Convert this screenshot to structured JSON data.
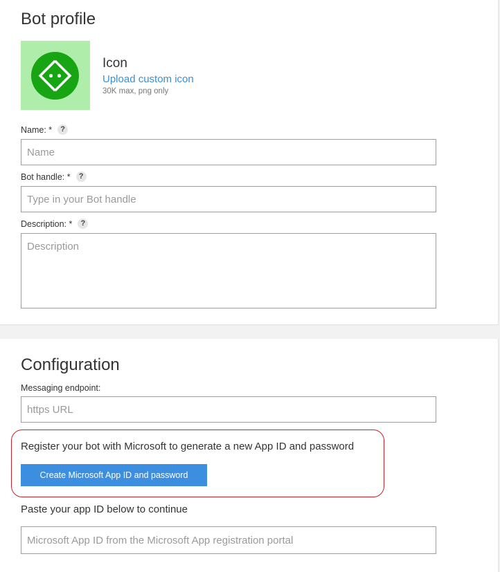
{
  "bot_profile": {
    "title": "Bot profile",
    "icon": {
      "heading": "Icon",
      "upload_link": "Upload custom icon",
      "hint": "30K max, png only",
      "bg_color": "#aeeeaa",
      "circle_color": "#17a514",
      "glyph": "code-brackets-icon"
    },
    "fields": {
      "name": {
        "label": "Name: *",
        "help": "?",
        "placeholder": "Name",
        "value": ""
      },
      "handle": {
        "label": "Bot handle: *",
        "help": "?",
        "placeholder": "Type in your Bot handle",
        "value": ""
      },
      "description": {
        "label": "Description: *",
        "help": "?",
        "placeholder": "Description",
        "value": ""
      }
    }
  },
  "configuration": {
    "title": "Configuration",
    "endpoint": {
      "label": "Messaging endpoint:",
      "placeholder": "https URL",
      "value": ""
    },
    "register_text": "Register your bot with Microsoft to generate a new App ID and password",
    "create_button": "Create Microsoft App ID and password",
    "paste_text": "Paste your app ID below to continue",
    "app_id": {
      "placeholder": "Microsoft App ID from the Microsoft App registration portal",
      "value": ""
    }
  },
  "colors": {
    "accent": "#3b8ee0",
    "link": "#3a8fd4",
    "callout_border": "#c8202a"
  }
}
